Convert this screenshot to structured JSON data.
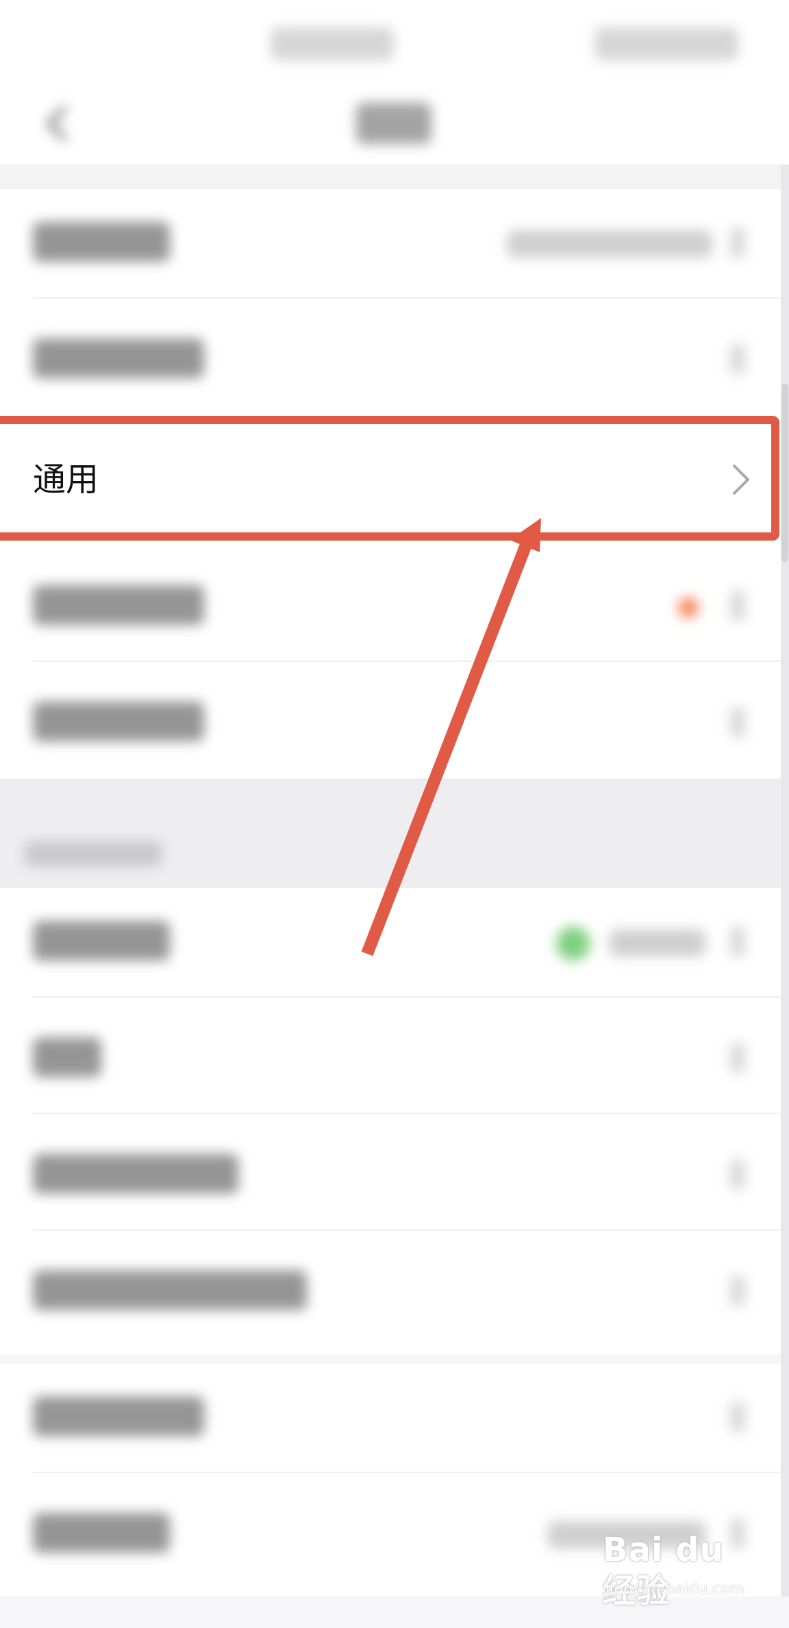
{
  "settings": {
    "general_label": "通用"
  },
  "watermark": {
    "brand": "Bai du 经验",
    "site": "jingyan.baidu.com"
  },
  "colors": {
    "highlight": "#e05a45",
    "text_primary": "#111111",
    "background": "#f6f6f8"
  },
  "icons": {
    "back": "chevron-left-icon",
    "row_chevron": "chevron-right-icon"
  }
}
